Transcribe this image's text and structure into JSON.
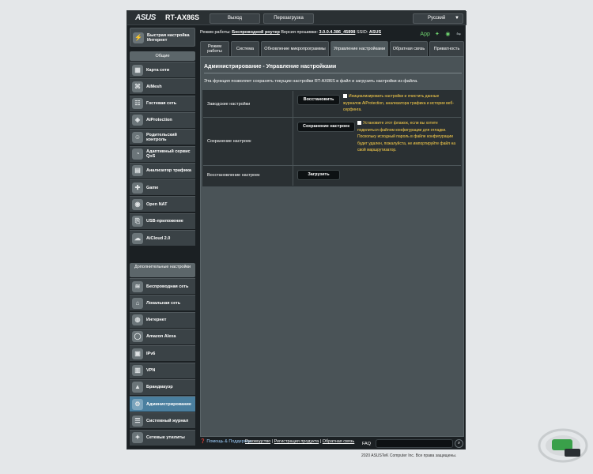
{
  "header": {
    "logo": "ASUS",
    "model": "RT-AX86S",
    "logout_label": "Выход",
    "reboot_label": "Перезагрузка",
    "language": "Русский"
  },
  "status": {
    "mode_label": "Режим работы:",
    "mode_value": "Беспроводной роутер",
    "firmware_label": "Версия прошивки:",
    "firmware_value": "3.0.0.4.386_45898",
    "ssid_label": "SSID:",
    "ssid_value": "ASUS",
    "app_label": "App"
  },
  "sidebar": {
    "quick_setup": "Быстрая настройка Интернет",
    "general_header": "Общие",
    "general_items": [
      {
        "label": "Карта сети",
        "icon": "network-map-icon",
        "glyph": "▦"
      },
      {
        "label": "AiMesh",
        "icon": "aimesh-icon",
        "glyph": "⌘"
      },
      {
        "label": "Гостевая сеть",
        "icon": "guest-network-icon",
        "glyph": "☷"
      },
      {
        "label": "AiProtection",
        "icon": "aiprotection-icon",
        "glyph": "◈"
      },
      {
        "label": "Родительский контроль",
        "icon": "parental-control-icon",
        "glyph": "☺"
      },
      {
        "label": "Адаптивный сервис QoS",
        "icon": "qos-icon",
        "glyph": "◔"
      },
      {
        "label": "Анализатор трафика",
        "icon": "traffic-analyzer-icon",
        "glyph": "▤"
      },
      {
        "label": "Game",
        "icon": "game-icon",
        "glyph": "✚"
      },
      {
        "label": "Open NAT",
        "icon": "open-nat-icon",
        "glyph": "◉"
      },
      {
        "label": "USB-приложение",
        "icon": "usb-icon",
        "glyph": "⎘"
      },
      {
        "label": "AiCloud 2.0",
        "icon": "aicloud-icon",
        "glyph": "☁"
      }
    ],
    "advanced_header": "Дополнительные настройки",
    "advanced_items": [
      {
        "label": "Беспроводная сеть",
        "icon": "wireless-icon",
        "glyph": "≋"
      },
      {
        "label": "Локальная сеть",
        "icon": "lan-icon",
        "glyph": "⌂"
      },
      {
        "label": "Интернет",
        "icon": "wan-icon",
        "glyph": "◍"
      },
      {
        "label": "Amazon Alexa",
        "icon": "alexa-icon",
        "glyph": "◯"
      },
      {
        "label": "IPv6",
        "icon": "ipv6-icon",
        "glyph": "▣"
      },
      {
        "label": "VPN",
        "icon": "vpn-icon",
        "glyph": "▥"
      },
      {
        "label": "Брандмауэр",
        "icon": "firewall-icon",
        "glyph": "▲"
      },
      {
        "label": "Администри­рование",
        "icon": "administration-icon",
        "glyph": "⚙"
      },
      {
        "label": "Системный журнал",
        "icon": "system-log-icon",
        "glyph": "☰"
      },
      {
        "label": "Сетевые утилиты",
        "icon": "network-tools-icon",
        "glyph": "✦"
      }
    ]
  },
  "tabs": [
    {
      "label": "Режим работы"
    },
    {
      "label": "Система"
    },
    {
      "label": "Обновление микропрограммы"
    },
    {
      "label": "Управление настройками"
    },
    {
      "label": "Обратная связь"
    },
    {
      "label": "Приватность"
    }
  ],
  "main": {
    "title": "Администрирование - Управление настройками",
    "description": "Эта функция позволяет сохранять текущие настройки RT-AX86S в файл и загрузить настройки из файла.",
    "rows": [
      {
        "label": "Заводские настройки",
        "button": "Восстановить",
        "note": "Инициализировать настройки и очистить данные журналов AiProtection, анализатора трафика и истории веб-серфинга."
      },
      {
        "label": "Сохранение настроек",
        "button": "Сохранение настроек",
        "note": "Установите этот флажок, если вы хотите поделиться файлом конфигурации для отладки. Поскольку исходный пароль в файле конфигурации будет удален, пожалуйста, не импортируйте файл на свой маршрутизатор."
      },
      {
        "label": "Восстановление настроек",
        "button": "Загрузить"
      }
    ]
  },
  "footer": {
    "help": "Помощь & Поддержка",
    "manual": "Руководство",
    "registration": "Регистрация продукта",
    "feedback": "Обратная связь",
    "faq": "FAQ",
    "copyright": "2020 ASUSTeK Computer Inc. Все права защищены."
  },
  "colors": {
    "accent_active": "#4a7f9f",
    "note_text": "#ffd24a",
    "panel": "#4a5357"
  }
}
